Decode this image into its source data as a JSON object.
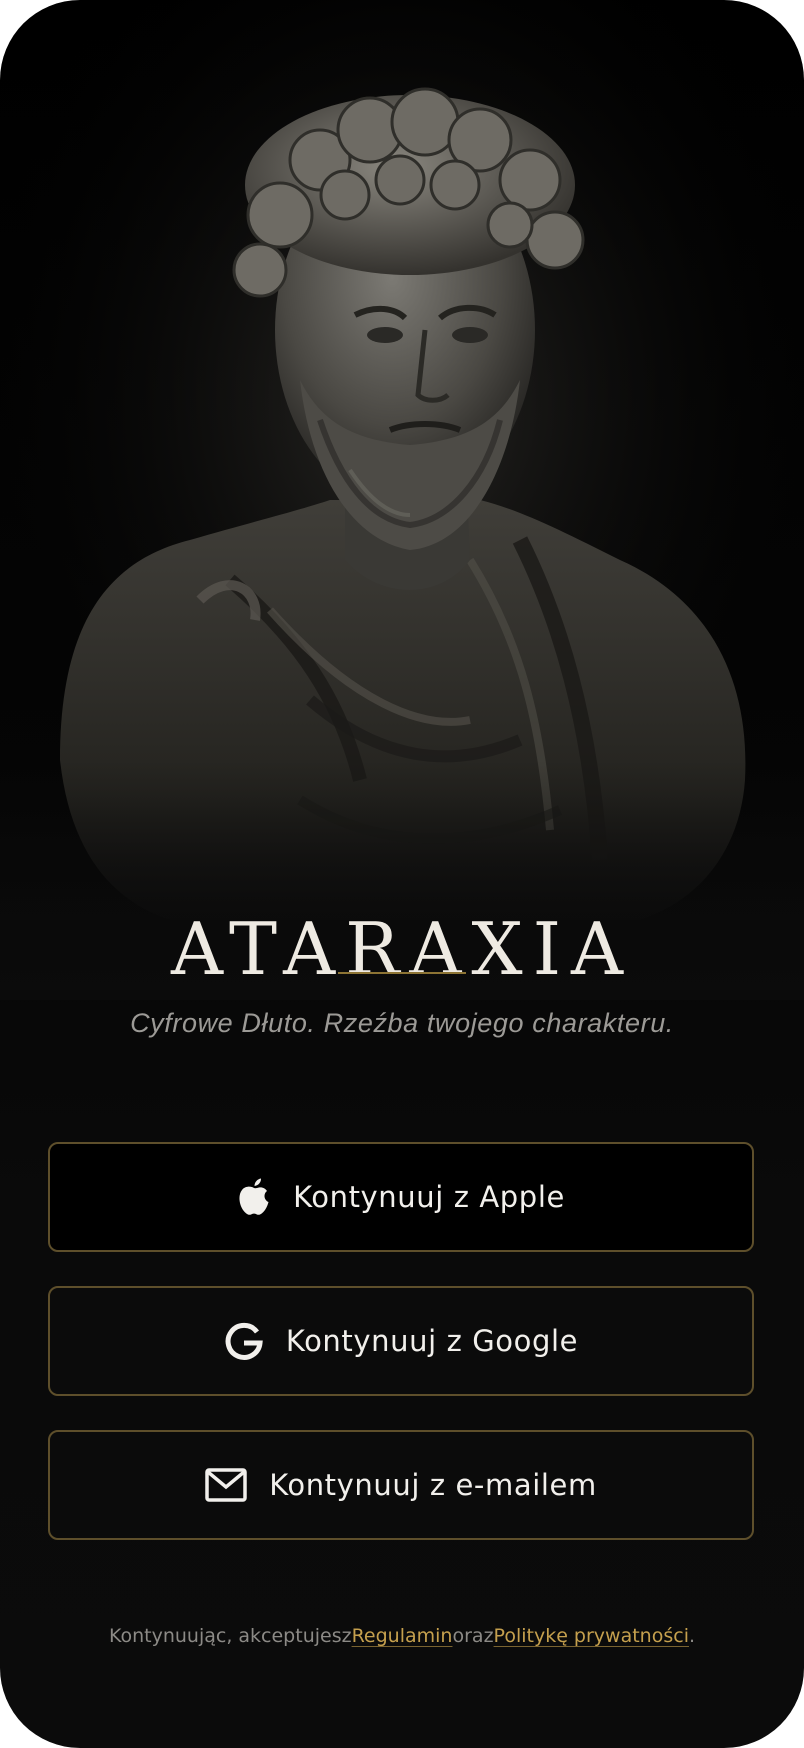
{
  "app": {
    "title": "ATARAXIA",
    "tagline": "Cyfrowe Dłuto. Rzeźba twojego charakteru."
  },
  "hero": {
    "image": "marble-philosopher-bust"
  },
  "buttons": {
    "apple": {
      "label": "Kontynuuj z Apple",
      "icon": "apple-icon"
    },
    "google": {
      "label": "Kontynuuj z Google",
      "icon": "google-icon"
    },
    "email": {
      "label": "Kontynuuj z e-mailem",
      "icon": "mail-icon"
    }
  },
  "legal": {
    "prefix": "Kontynuując, akceptujesz",
    "terms_link": "Regulamin",
    "conjunction": "oraz",
    "privacy_link": "Politykę prywatności",
    "suffix": "."
  },
  "colors": {
    "background": "#0b0b0b",
    "accent": "#c5a04e",
    "button_border": "#5e4f2b",
    "title": "#eeeae2"
  }
}
